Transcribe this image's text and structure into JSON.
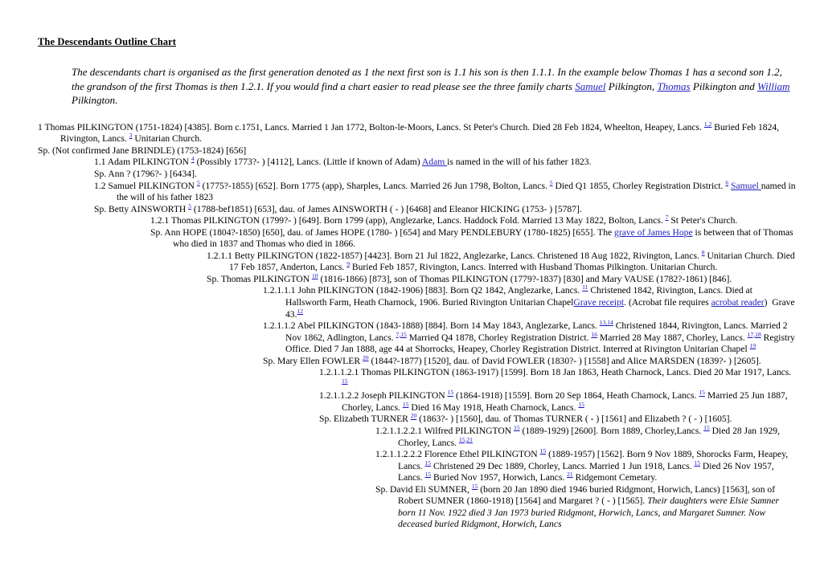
{
  "document": {
    "title": "The Descendants Outline Chart",
    "intro": {
      "text_before_links": "The descendants chart is organised as the first generation denoted as 1 the next first son is 1.1 his son is then 1.1.1. In the example below Thomas 1 has a second son 1.2, the grandson of the first Thomas is then 1.2.1. If you would find a chart easier to read please see the three family charts ",
      "link_samuel": "Samuel",
      "after_samuel": " Pilkington,   ",
      "link_thomas": "Thomas",
      "after_thomas": " Pilkington and ",
      "link_william": "William",
      "after_william": "  Pilkington."
    }
  },
  "link_color": "#1414c8",
  "entries": [
    {
      "id": "entry-1-thomas-pilkington",
      "indent": 0,
      "hang": 28,
      "html": "1 Thomas PILKINGTON (1751-1824) [4385]. Born c.1751, Lancs. Married 1 Jan 1772, Bolton-le-Moors, Lancs. St Peter's Church. Died 28 Feb 1824, Wheelton, Heapey, Lancs. <sup class=\"fn\"><a class=\"lnk\" href=\"#\">1,2</a></sup> Buried Feb 1824, Rivington, Lancs. <sup class=\"fn\"><a class=\"lnk\" href=\"#\">3</a></sup> Unitarian Church."
    },
    {
      "id": "entry-sp-jane-brindle",
      "indent": 0,
      "hang": 28,
      "html": "Sp. (Not confirmed Jane BRINDLE) (1753-1824) [656]"
    },
    {
      "id": "entry-1-1-adam-pilkington",
      "indent": 70,
      "hang": 28,
      "html": "1.1 Adam PILKINGTON <sup class=\"fn\"><a class=\"lnk\" href=\"#\">4</a></sup> (Possibly 1773?- ) [4112], Lancs. (Little if known of Adam) <a class=\"lnk\" href=\"#\">Adam </a>is named in the will of his father 1823."
    },
    {
      "id": "entry-sp-ann",
      "indent": 70,
      "hang": 28,
      "html": "Sp. Ann ? (1796?- ) [6434]."
    },
    {
      "id": "entry-1-2-samuel-pilkington",
      "indent": 70,
      "hang": 28,
      "html": "1.2 Samuel PILKINGTON <sup class=\"fn\"><a class=\"lnk\" href=\"#\">5</a></sup> (1775?-1855) [652]. Born 1775 (app), Sharples, Lancs. Married 26 Jun 1798, Bolton, Lancs. <sup class=\"fn\"><a class=\"lnk\" href=\"#\">5</a></sup> Died Q1 1855, Chorley Registration District. <sup class=\"fn\"><a class=\"lnk\" href=\"#\">6</a></sup> <a class=\"lnk\" href=\"#\">Samuel </a>named in the will of his father 1823"
    },
    {
      "id": "entry-sp-betty-ainsworth",
      "indent": 70,
      "hang": 28,
      "html": "Sp. Betty AINSWORTH <sup class=\"fn\"><a class=\"lnk\" href=\"#\">5</a></sup> (1788-bef1851) [653], dau. of James AINSWORTH ( - ) [6468] and Eleanor HICKING (1753- ) [5787]."
    },
    {
      "id": "entry-1-2-1-thomas-pilkington",
      "indent": 140,
      "hang": 28,
      "html": "1.2.1 Thomas PILKINGTON (1799?- ) [649]. Born 1799 (app), Anglezarke, Lancs. Haddock Fold. Married 13 May 1822, Bolton, Lancs. <sup class=\"fn\"><a class=\"lnk\" href=\"#\">7</a></sup> St Peter's Church."
    },
    {
      "id": "entry-sp-ann-hope",
      "indent": 140,
      "hang": 28,
      "html": "Sp. Ann HOPE (1804?-1850) [650], dau. of James HOPE (1780- ) [654] and Mary PENDLEBURY (1780-1825) [655]. The <a class=\"lnk\" href=\"#\">grave of James Hope</a> is between that of Thomas who died in 1837 and Thomas who died in 1866."
    },
    {
      "id": "entry-1-2-1-1-betty-pilkington",
      "indent": 210,
      "hang": 28,
      "html": "1.2.1.1 Betty PILKINGTON (1822-1857) [4423]. Born 21 Jul 1822, Anglezarke, Lancs. Christened 18 Aug 1822, Rivington, Lancs. <sup class=\"fn\"><a class=\"lnk\" href=\"#\">8</a></sup> Unitarian Church. Died 17 Feb 1857, Anderton, Lancs. <sup class=\"fn\"><a class=\"lnk\" href=\"#\">9</a></sup> Buried Feb 1857, Rivington, Lancs. Interred with Husband Thomas Pilkington. Unitarian Church."
    },
    {
      "id": "entry-sp-thomas-pilkington-1816",
      "indent": 210,
      "hang": 28,
      "html": "Sp. Thomas PILKINGTON <sup class=\"fn\"><a class=\"lnk\" href=\"#\">10</a></sup> (1816-1866) [873], son of Thomas PILKINGTON (1779?-1837) [830] and Mary VAUSE (1782?-1861) [846]."
    },
    {
      "id": "entry-1-2-1-1-1-john-pilkington",
      "indent": 280,
      "hang": 28,
      "html": "1.2.1.1.1 John PILKINGTON (1842-1906) [883]. Born Q2 1842, Anglezarke, Lancs. <sup class=\"fn\"><a class=\"lnk\" href=\"#\">11</a></sup> Christened 1842, Rivington, Lancs. Died at Hallsworth Farm, Heath Charnock, 1906. Buried Rivington Unitarian Chapel<a class=\"lnk\" href=\"#\">Grave receipt</a>. (Acrobat file requires <a class=\"lnk\" href=\"#\">acrobat reader</a>)&nbsp; Grave 43.<sup class=\"fn\"><a class=\"lnk\" href=\"#\">12</a></sup>"
    },
    {
      "id": "entry-1-2-1-1-2-abel-pilkington",
      "indent": 280,
      "hang": 28,
      "html": "1.2.1.1.2 Abel PILKINGTON (1843-1888) [884]. Born 14 May 1843, Anglezarke, Lancs. <sup class=\"fn\"><a class=\"lnk\" href=\"#\">13,14</a></sup> Christened 1844, Rivington, Lancs. Married 2 Nov 1862, Adlington, Lancs. <sup class=\"fn\"><a class=\"lnk\" href=\"#\">7,15</a></sup> Married Q4 1878, Chorley Registration District. <sup class=\"fn\"><a class=\"lnk\" href=\"#\">16</a></sup> Married 28 May 1887, Chorley, Lancs. <sup class=\"fn\"><a class=\"lnk\" href=\"#\">17,18</a></sup> Registry Office. Died 7 Jan 1888, age 44 at Shorrocks, Heapey, Chorley Registration District. Interred at Rivington Unitarian Chapel <sup class=\"fn\"><a class=\"lnk\" href=\"#\">19</a></sup>"
    },
    {
      "id": "entry-sp-mary-ellen-fowler",
      "indent": 280,
      "hang": 28,
      "html": "Sp. Mary Ellen FOWLER <sup class=\"fn\"><a class=\"lnk\" href=\"#\">20</a></sup> (1844?-1877) [1520], dau. of David FOWLER (1830?- ) [1558] and Alice MARSDEN (1839?- ) [2605]."
    },
    {
      "id": "entry-1-2-1-1-2-1-thomas-pilkington",
      "indent": 350,
      "hang": 28,
      "html": "1.2.1.1.2.1 Thomas PILKINGTON (1863-1917) [1599]. Born 18 Jan 1863, Heath Charnock, Lancs. Died 20 Mar 1917, Lancs. <sup class=\"fn\"><a class=\"lnk\" href=\"#\">15</a></sup>"
    },
    {
      "id": "entry-1-2-1-1-2-2-joseph-pilkington",
      "indent": 350,
      "hang": 28,
      "html": "1.2.1.1.2.2 Joseph PILKINGTON <sup class=\"fn\"><a class=\"lnk\" href=\"#\">15</a></sup> (1864-1918) [1559]. Born 20 Sep 1864, Heath Charnock, Lancs. <sup class=\"fn\"><a class=\"lnk\" href=\"#\">15</a></sup> Married 25 Jun 1887, Chorley, Lancs. <sup class=\"fn\"><a class=\"lnk\" href=\"#\">15</a></sup> Died 16 May 1918, Heath Charnock, Lancs. <sup class=\"fn\"><a class=\"lnk\" href=\"#\">15</a></sup>"
    },
    {
      "id": "entry-sp-elizabeth-turner",
      "indent": 350,
      "hang": 28,
      "html": "Sp. Elizabeth TURNER <sup class=\"fn\"><a class=\"lnk\" href=\"#\">20</a></sup> (1863?- ) [1560], dau. of Thomas TURNER ( - ) [1561] and Elizabeth ? ( - ) [1605]."
    },
    {
      "id": "entry-1-2-1-1-2-2-1-wilfred-pilkington",
      "indent": 420,
      "hang": 28,
      "html": "1.2.1.1.2.2.1 Wilfred PILKINGTON <sup class=\"fn\"><a class=\"lnk\" href=\"#\">15</a></sup> (1889-1929) [2600]. Born 1889, Chorley,Lancs. <sup class=\"fn\"><a class=\"lnk\" href=\"#\">15</a></sup> Died 28 Jan 1929, Chorley, Lancs. <sup class=\"fn\"><a class=\"lnk\" href=\"#\">15,21</a></sup>"
    },
    {
      "id": "entry-1-2-1-1-2-2-2-florence-ethel-pilkington",
      "indent": 420,
      "hang": 28,
      "html": "1.2.1.1.2.2.2 Florence Ethel PILKINGTON <sup class=\"fn\"><a class=\"lnk\" href=\"#\">15</a></sup> (1889-1957) [1562]. Born 9 Nov 1889, Shorocks Farm, Heapey, Lancs. <sup class=\"fn\"><a class=\"lnk\" href=\"#\">15</a></sup> Christened 29 Dec 1889, Chorley, Lancs. Married 1 Jun 1918, Lancs. <sup class=\"fn\"><a class=\"lnk\" href=\"#\">15</a></sup> Died 26 Nov 1957, Lancs. <sup class=\"fn\"><a class=\"lnk\" href=\"#\">15</a></sup> Buried Nov 1957, Horwich, Lancs. <sup class=\"fn\"><a class=\"lnk\" href=\"#\">21</a></sup> Ridgemont Cemetary."
    },
    {
      "id": "entry-sp-david-eli-sumner",
      "indent": 420,
      "hang": 28,
      "html": "Sp. David Eli SUMNER, <sup class=\"fn\"><a class=\"lnk\" href=\"#\">15</a></sup> (born 20 Jan 1890 died 1946 buried Ridgmont, Horwich, Lancs) [1563], son of Robert SUMNER (1860-1918) [1564] and Margaret ? ( - ) [1565]. <span class=\"it\">Their daughters were Elsie Sumner born 11 Nov. 1922 died 3 Jan 1973 buried Ridgmont, Horwich, Lancs, and Margaret Sumner. Now deceased buried Ridgmont, Horwich, Lancs</span>"
    }
  ]
}
